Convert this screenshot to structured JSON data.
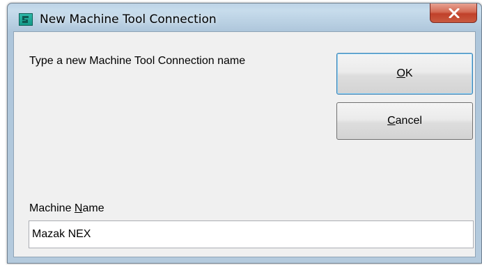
{
  "window": {
    "title": "New Machine Tool Connection",
    "app_icon": "machine-tool-app-icon",
    "close_icon": "close-icon"
  },
  "dialog": {
    "prompt": "Type a new Machine Tool Connection name",
    "ok_button": {
      "mnemonic": "O",
      "rest": "K"
    },
    "cancel_button": {
      "mnemonic": "C",
      "rest": "ancel"
    },
    "machine_name_label": {
      "before": "Machine ",
      "mnemonic": "N",
      "after": "ame"
    },
    "machine_name_value": "Mazak NEX"
  },
  "colors": {
    "title_bar": "#b7cee1",
    "client_background": "#f0f0f0",
    "close_button": "#c95a40",
    "default_button_border": "#3c7fb1"
  }
}
